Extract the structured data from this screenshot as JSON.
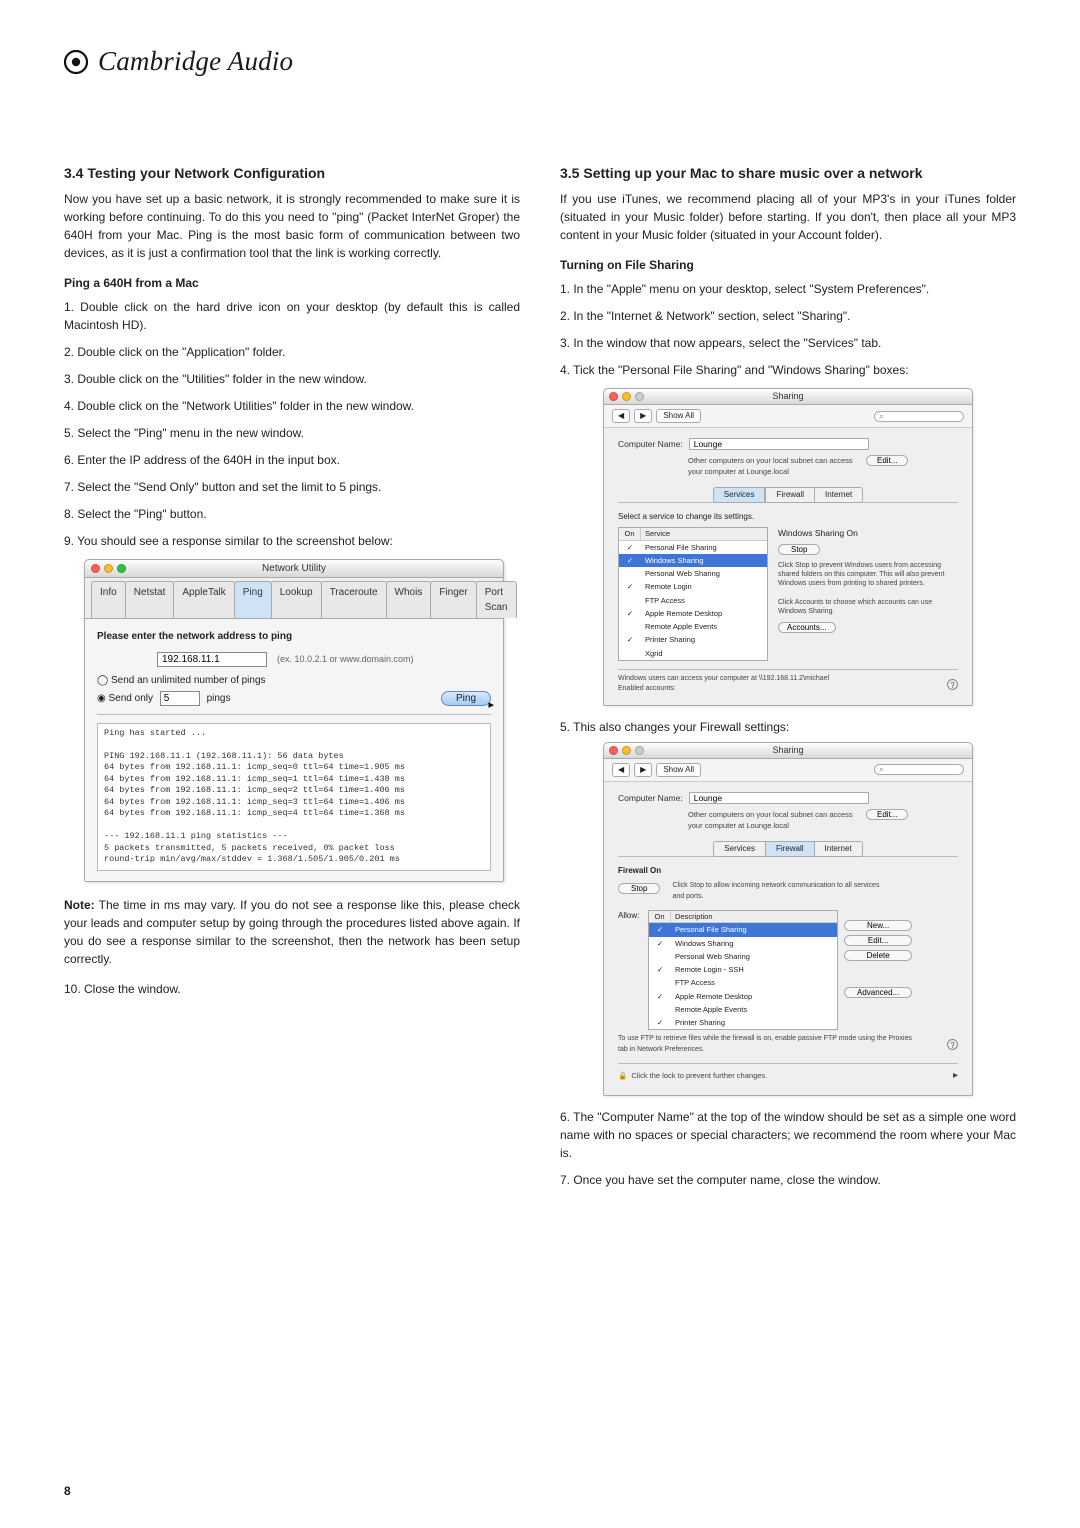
{
  "brand": "Cambridge Audio",
  "page_number": "8",
  "left": {
    "h2": "3.4 Testing your Network Configuration",
    "intro": "Now you have set up a basic network, it is strongly recommended to make sure it is working before continuing. To do this you need to \"ping\" (Packet InterNet Groper) the 640H from your Mac. Ping is the most basic form of communication between two devices, as it is just a confirmation tool that the link is working correctly.",
    "sub1": "Ping a 640H from a Mac",
    "steps": [
      "1. Double click on the hard drive icon on your desktop (by default this is called Macintosh HD).",
      "2. Double click on the \"Application\" folder.",
      "3. Double click on the \"Utilities\" folder in the new window.",
      "4. Double click on the \"Network Utilities\" folder in the new window.",
      "5. Select the \"Ping\" menu in the new window.",
      "6. Enter the IP address of the 640H in the input box.",
      "7. Select the \"Send Only\" button and set the limit to 5 pings.",
      "8. Select the \"Ping\" button.",
      "9. You should see a response similar to the screenshot below:"
    ],
    "note_label": "Note:",
    "note": " The time in ms may vary. If you do not see a response like this, please check your leads and computer setup by going through the procedures listed above again. If you do see a response similar to the screenshot, then the network has been setup correctly.",
    "step10": "10. Close the window.",
    "netutil": {
      "title": "Network Utility",
      "tabs": [
        "Info",
        "Netstat",
        "AppleTalk",
        "Ping",
        "Lookup",
        "Traceroute",
        "Whois",
        "Finger",
        "Port Scan"
      ],
      "active_tab": "Ping",
      "prompt": "Please enter the network address to ping",
      "ip": "192.168.11.1",
      "ip_hint": "(ex. 10.0.2.1 or www.domain.com)",
      "radio1": "Send an unlimited number of pings",
      "radio2a": "Send only",
      "radio2_val": "5",
      "radio2b": "pings",
      "ping_btn": "Ping",
      "term": "Ping has started ...\n\nPING 192.168.11.1 (192.168.11.1): 56 data bytes\n64 bytes from 192.168.11.1: icmp_seq=0 ttl=64 time=1.905 ms\n64 bytes from 192.168.11.1: icmp_seq=1 ttl=64 time=1.438 ms\n64 bytes from 192.168.11.1: icmp_seq=2 ttl=64 time=1.406 ms\n64 bytes from 192.168.11.1: icmp_seq=3 ttl=64 time=1.406 ms\n64 bytes from 192.168.11.1: icmp_seq=4 ttl=64 time=1.368 ms\n\n--- 192.168.11.1 ping statistics ---\n5 packets transmitted, 5 packets received, 0% packet loss\nround-trip min/avg/max/stddev = 1.368/1.505/1.905/0.201 ms"
    }
  },
  "right": {
    "h2": "3.5 Setting up your Mac to share music over a network",
    "intro": "If you use iTunes, we recommend placing all of your MP3's in your iTunes folder (situated in your Music folder) before starting. If you don't, then place all your MP3 content in your Music folder (situated in your Account folder).",
    "sub1": "Turning on File Sharing",
    "steps_a": [
      "1. In the \"Apple\" menu on your desktop, select \"System Preferences\".",
      "2. In the \"Internet & Network\" section, select \"Sharing\".",
      "3. In the window that now appears, select the \"Services\" tab.",
      "4. Tick the \"Personal File Sharing\" and \"Windows Sharing\" boxes:"
    ],
    "step5": "5. This also changes your Firewall settings:",
    "steps_b": [
      "6. The \"Computer Name\" at the top of the window should be set as a simple one word name with no spaces or special characters; we recommend the room where your Mac is.",
      "7. Once you have set the computer name, close the window."
    ],
    "sharing": {
      "title": "Sharing",
      "showall": "Show All",
      "search_icon": "⌕",
      "name_label": "Computer Name:",
      "name_value": "Lounge",
      "name_hint": "Other computers on your local subnet can access your computer at Lounge.local",
      "edit": "Edit...",
      "tabs": [
        "Services",
        "Firewall",
        "Internet"
      ],
      "sel_prompt": "Select a service to change its settings.",
      "list_head_on": "On",
      "list_head_svc": "Service",
      "services": [
        {
          "on": "✓",
          "name": "Personal File Sharing",
          "sel": false
        },
        {
          "on": "✓",
          "name": "Windows Sharing",
          "sel": true
        },
        {
          "on": "",
          "name": "Personal Web Sharing",
          "sel": false
        },
        {
          "on": "✓",
          "name": "Remote Login",
          "sel": false
        },
        {
          "on": "",
          "name": "FTP Access",
          "sel": false
        },
        {
          "on": "✓",
          "name": "Apple Remote Desktop",
          "sel": false
        },
        {
          "on": "",
          "name": "Remote Apple Events",
          "sel": false
        },
        {
          "on": "✓",
          "name": "Printer Sharing",
          "sel": false
        },
        {
          "on": "",
          "name": "Xgrid",
          "sel": false
        }
      ],
      "status": "Windows Sharing On",
      "stop": "Stop",
      "desc1": "Click Stop to prevent Windows users from accessing shared folders on this computer. This will also prevent Windows users from printing to shared printers.",
      "desc2": "Click Accounts to choose which accounts can use Windows Sharing.",
      "accounts": "Accounts...",
      "foot1": "Windows users can access your computer at \\\\192.168.11.2\\michael",
      "foot2": "Enabled accounts:",
      "help": "?"
    },
    "firewall": {
      "title": "Sharing",
      "showall": "Show All",
      "name_label": "Computer Name:",
      "name_value": "Lounge",
      "name_hint": "Other computers on your local subnet can access your computer at Lounge.local",
      "edit": "Edit...",
      "tabs": [
        "Services",
        "Firewall",
        "Internet"
      ],
      "status_label": "Firewall On",
      "stop": "Stop",
      "stop_note": "Click Stop to allow incoming network communication to all services and ports.",
      "allow": "Allow:",
      "list_head_on": "On",
      "list_head_svc": "Description",
      "services": [
        {
          "on": "✓",
          "name": "Personal File Sharing",
          "sel": true
        },
        {
          "on": "✓",
          "name": "Windows Sharing",
          "sel": false
        },
        {
          "on": "",
          "name": "Personal Web Sharing",
          "sel": false
        },
        {
          "on": "✓",
          "name": "Remote Login - SSH",
          "sel": false
        },
        {
          "on": "",
          "name": "FTP Access",
          "sel": false
        },
        {
          "on": "✓",
          "name": "Apple Remote Desktop",
          "sel": false
        },
        {
          "on": "",
          "name": "Remote Apple Events",
          "sel": false
        },
        {
          "on": "✓",
          "name": "Printer Sharing",
          "sel": false
        }
      ],
      "btn_new": "New...",
      "btn_edit": "Edit...",
      "btn_delete": "Delete",
      "btn_adv": "Advanced...",
      "tip": "To use FTP to retrieve files while the firewall is on, enable passive FTP mode using the Proxies tab in Network Preferences.",
      "lock": "Click the lock to prevent further changes.",
      "help": "?"
    }
  }
}
